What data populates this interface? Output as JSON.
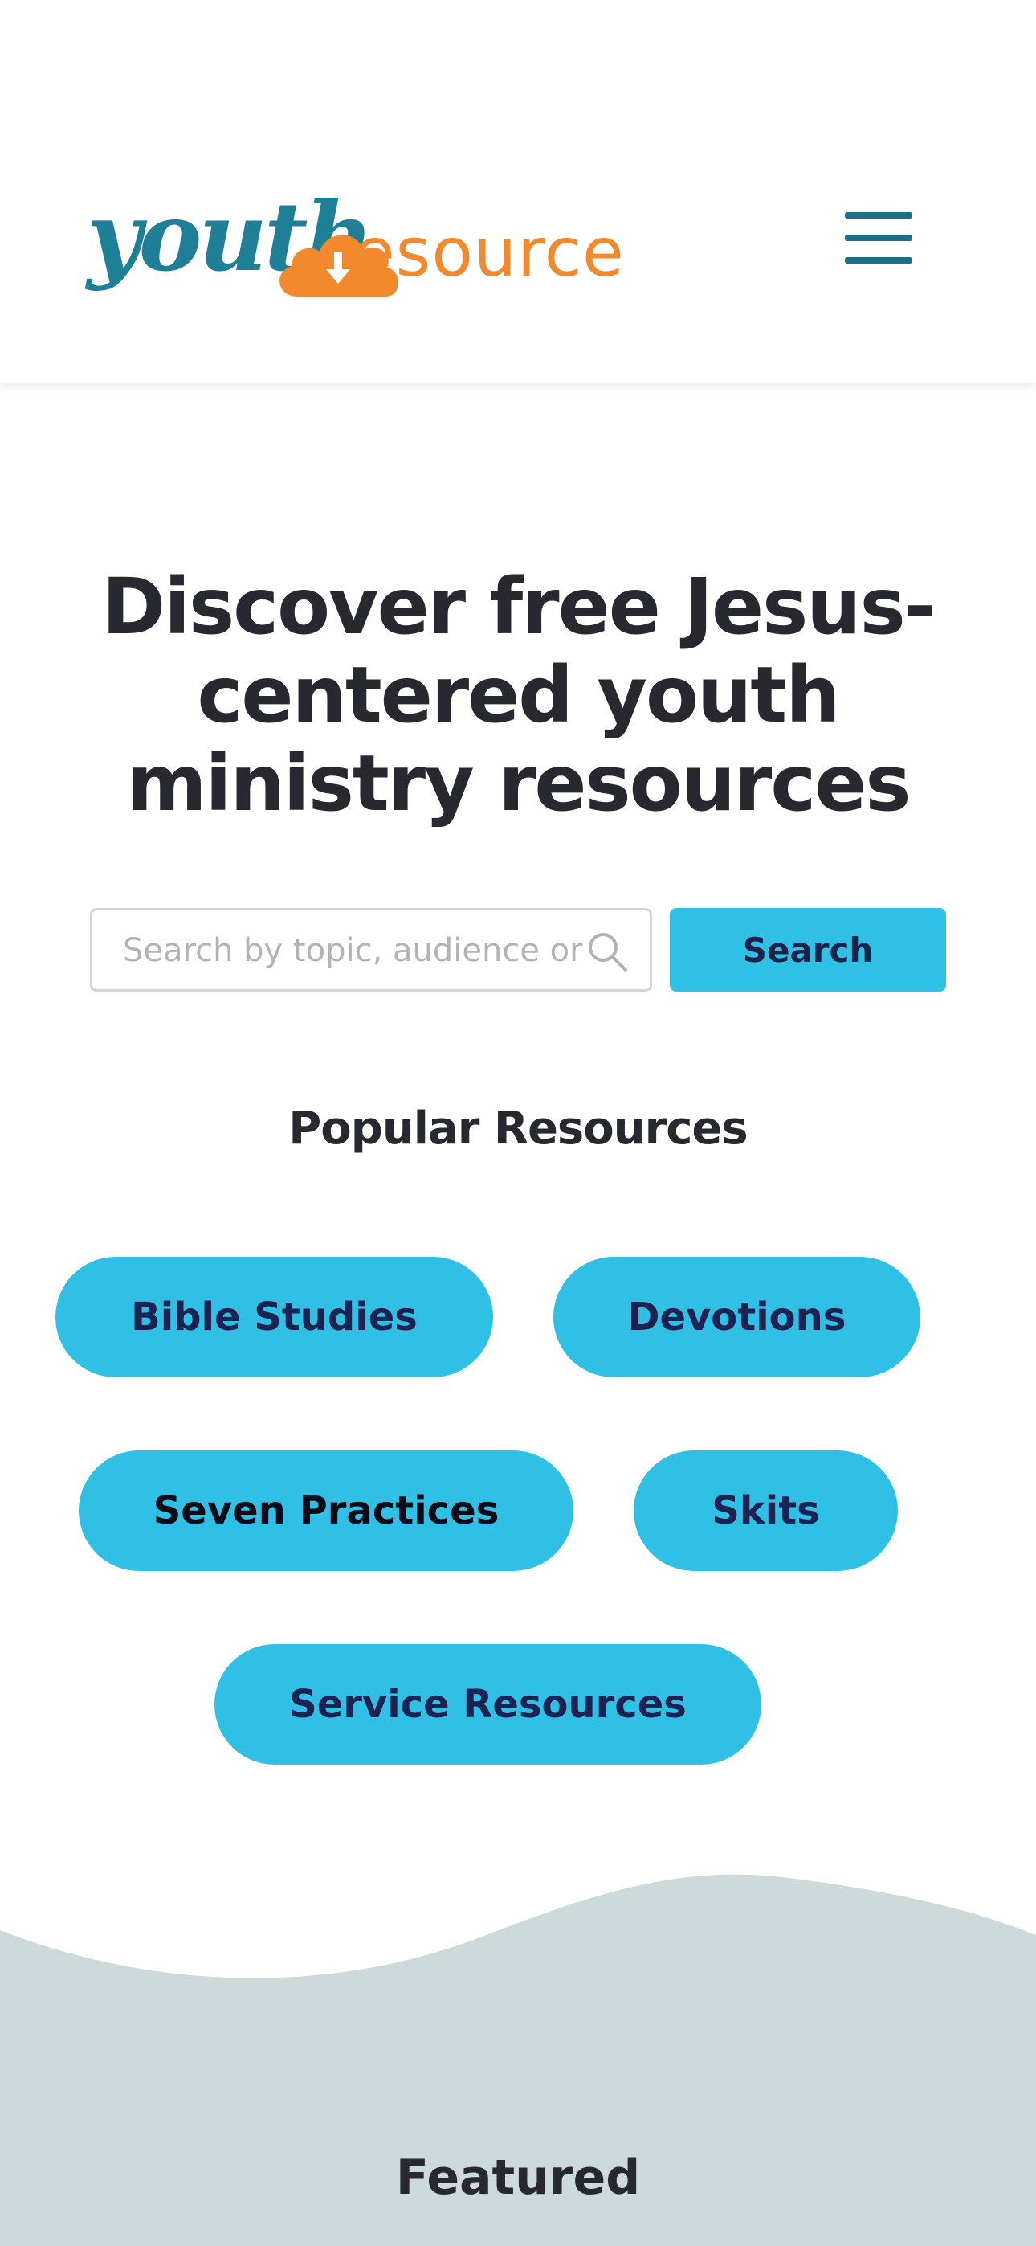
{
  "header": {
    "logo": {
      "part1": "youth",
      "part2": "esource"
    },
    "menu_icon": "hamburger-menu-icon"
  },
  "hero": {
    "title": "Discover free Jesus-centered youth ministry resources"
  },
  "search": {
    "placeholder": "Search by topic, audience or",
    "button_label": "Search",
    "icon": "search-icon"
  },
  "popular": {
    "title": "Popular Resources",
    "items": [
      {
        "label": "Bible Studies"
      },
      {
        "label": "Devotions"
      },
      {
        "label": "Seven Practices"
      },
      {
        "label": "Skits"
      },
      {
        "label": "Service Resources"
      }
    ]
  },
  "featured": {
    "title": "Featured"
  },
  "colors": {
    "teal_logo": "#1f7f96",
    "orange_logo": "#f2892c",
    "accent": "#31c0e5",
    "button_text": "#1e2249",
    "heading_text": "#282831",
    "wave": "#cddadc"
  }
}
